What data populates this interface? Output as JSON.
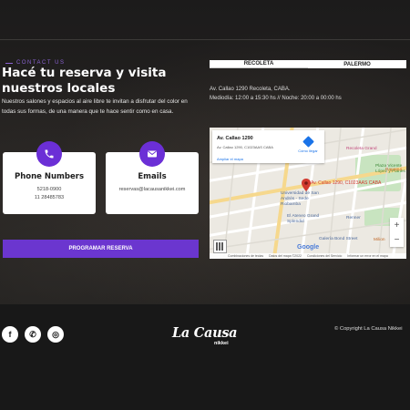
{
  "section": {
    "kicker": "CONTACT US",
    "title": "Hacé tu reserva y visita nuestros locales",
    "description": "Nuestros salones y espacios al aire libre te invitan a disfrutar del color en todas sus formas, de una manera que te hace sentir como en casa."
  },
  "cards": [
    {
      "icon": "phone-icon",
      "title": "Phone Numbers",
      "lines": [
        "5218-0900",
        "11 28485783"
      ]
    },
    {
      "icon": "email-icon",
      "title": "Emails",
      "lines": [
        "reservas@lacausanikkei.com"
      ]
    }
  ],
  "cta": {
    "label": "PROGRAMAR RESERVA"
  },
  "tabs": [
    {
      "label": "RECOLETA",
      "active": true
    },
    {
      "label": "PALERMO",
      "active": false
    }
  ],
  "location": {
    "address": "Av. Callao 1290 Recoleta, CABA.",
    "hours": "Mediodía: 12:00 a 15:30 hs // Noche: 20:00 a 00:00 hs"
  },
  "map": {
    "place_name": "Av. Callao 1290",
    "place_address": "Av. Callao 1290, C1023AAS CABA",
    "view_larger": "Ampliar el mapa",
    "directions": "Cómo llegar",
    "pin_label": "Av. Callao 1290, C1023AAS CABA",
    "labels": {
      "recoleta_grand": "Recoleta Grand",
      "plaza": "Plaza Vicente López y Planes",
      "rapanui": "Rapanui",
      "universidad": "Universidad de San Andrés - Sede Riobamba",
      "ateneo": "El Ateneo Grand Splendid",
      "bond": "Galería Bond Street",
      "renner": "Renner",
      "milion": "Milion"
    },
    "zoom_in": "+",
    "zoom_out": "−",
    "google": "Google",
    "footer": [
      "Combinaciones de teclas",
      "Datos del mapa ©2022",
      "Condiciones del Servicio",
      "Informar un error en el mapa"
    ]
  },
  "footer": {
    "social": [
      {
        "icon": "facebook-icon",
        "glyph": "f"
      },
      {
        "icon": "whatsapp-icon",
        "glyph": "✆"
      },
      {
        "icon": "instagram-icon",
        "glyph": "◎"
      }
    ],
    "logo_main": "La Causa",
    "logo_sub": "nikkei",
    "copyright": "© Copyright La Causa Nikkei"
  },
  "colors": {
    "accent": "#6b36cf",
    "background": "#181818",
    "pin": "#d23a2f",
    "map_link": "#1a73e8"
  }
}
